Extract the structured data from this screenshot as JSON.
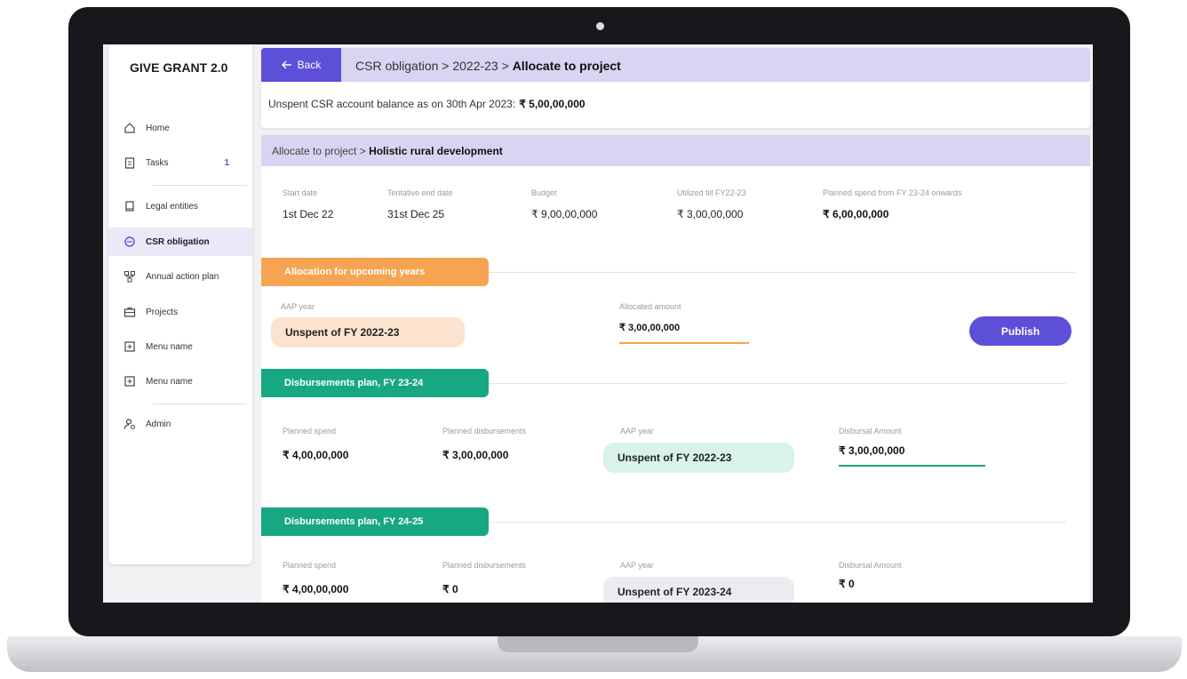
{
  "app": {
    "title": "GIVE GRANT 2.0"
  },
  "sidebar": {
    "items": [
      {
        "label": "Home",
        "icon": "home-icon"
      },
      {
        "label": "Tasks",
        "icon": "clipboard-icon",
        "count": "1"
      },
      {
        "label": "Legal entities",
        "icon": "document-icon"
      },
      {
        "label": "CSR obligation",
        "icon": "target-icon",
        "active": true
      },
      {
        "label": "Annual action plan",
        "icon": "hierarchy-icon"
      },
      {
        "label": "Projects",
        "icon": "briefcase-icon"
      },
      {
        "label": "Menu name",
        "icon": "plus-square-icon"
      },
      {
        "label": "Menu name",
        "icon": "plus-square-icon"
      },
      {
        "label": "Admin",
        "icon": "user-gear-icon"
      }
    ]
  },
  "header": {
    "back_label": "Back",
    "breadcrumb_path": "CSR obligation > 2022-23 > ",
    "breadcrumb_current": "Allocate to project"
  },
  "balance": {
    "label": "Unspent CSR account balance as on 30th Apr 2023:",
    "amount": "₹ 5,00,00,000"
  },
  "project": {
    "breadcrumb_path": "Allocate to project > ",
    "breadcrumb_current": "Holistic rural development",
    "fields": [
      {
        "label": "Start date",
        "value": "1st Dec 22"
      },
      {
        "label": "Tentative end date",
        "value": "31st Dec 25"
      },
      {
        "label": "Budget",
        "value": "₹ 9,00,00,000"
      },
      {
        "label": "Utilized till FY22-23",
        "value": "₹ 3,00,00,000"
      },
      {
        "label": "Planned spend from FY 23-24 onwards",
        "value": "₹ 6,00,00,000"
      }
    ]
  },
  "allocation": {
    "title": "Allocation for upcoming years",
    "aap_label": "AAP year",
    "aap_value": "Unspent of FY 2022-23",
    "amount_label": "Allocated amount",
    "amount_value": "₹ 3,00,00,000",
    "publish_label": "Publish"
  },
  "plans": [
    {
      "title": "Disbursements plan, FY 23-24",
      "planned_spend_label": "Planned spend",
      "planned_spend": "₹ 4,00,00,000",
      "planned_disb_label": "Planned disbursements",
      "planned_disb": "₹ 3,00,00,000",
      "aap_label": "AAP year",
      "aap_value": "Unspent of FY 2022-23",
      "disbursal_label": "Disbursal Amount",
      "disbursal_value": "₹ 3,00,00,000"
    },
    {
      "title": "Disbursements plan, FY 24-25",
      "planned_spend_label": "Planned spend",
      "planned_spend": "₹ 4,00,00,000",
      "planned_disb_label": "Planned disbursements",
      "planned_disb": "₹ 0",
      "aap_label": "AAP year",
      "aap_value": "Unspent of FY 2023-24",
      "disbursal_label": "Disbursal Amount",
      "disbursal_value": "₹ 0"
    }
  ],
  "colors": {
    "accent": "#5d4fd8",
    "header_bg": "#d8d4f2",
    "orange": "#f7a452",
    "green": "#17a883"
  }
}
